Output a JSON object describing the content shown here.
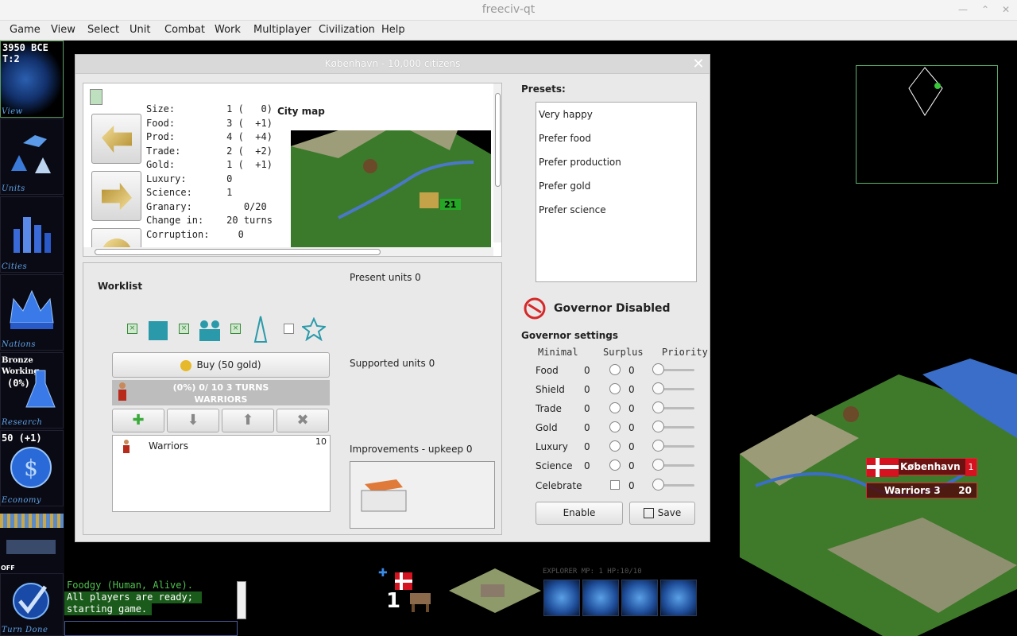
{
  "window": {
    "title": "freeciv-qt"
  },
  "menu": [
    "Game",
    "View",
    "Select",
    "Unit",
    "Combat",
    "Work",
    "Multiplayer",
    "Civilization",
    "Help"
  ],
  "sidebar": {
    "date": "3950 BCE",
    "turn": "T:2",
    "view_label": "View",
    "units_label": "Units",
    "cities_label": "Cities",
    "nations_label": "Nations",
    "research_title": "Bronze Working",
    "research_pct": "(0%)",
    "research_label": "Research",
    "gold": "50 (+1)",
    "economy_label": "Economy",
    "off_label": "OFF",
    "turn_done_label": "Turn Done"
  },
  "dialog": {
    "title": "København - 10,000 citizens",
    "stats": [
      {
        "label": "Size:",
        "value": "1 (   0)"
      },
      {
        "label": "Food:",
        "value": "3 (  +1)"
      },
      {
        "label": "Prod:",
        "value": "4 (  +4)"
      },
      {
        "label": "Trade:",
        "value": "2 (  +2)"
      },
      {
        "label": "Gold:",
        "value": "1 (  +1)"
      },
      {
        "label": "Luxury:",
        "value": "0"
      },
      {
        "label": "Science:",
        "value": "1"
      },
      {
        "label": "Granary:",
        "value": "   0/20"
      },
      {
        "label": "Change in:",
        "value": "20 turns"
      },
      {
        "label": "Corruption:",
        "value": "  0"
      }
    ],
    "city_map_label": "City map",
    "worklist_label": "Worklist",
    "buy_label": "Buy (50 gold)",
    "progress_line1": "(0%) 0/ 10 3 TURNS",
    "progress_line2": "WARRIORS",
    "worklist_items": [
      {
        "name": "Warriors",
        "cost": "10"
      }
    ],
    "present_units": "Present units 0",
    "supported_units": "Supported units 0",
    "improvements": "Improvements - upkeep 0",
    "presets_label": "Presets:",
    "presets": [
      "Very happy",
      "Prefer food",
      "Prefer production",
      "Prefer gold",
      "Prefer science"
    ],
    "governor_status": "Governor Disabled",
    "governor_settings_label": "Governor settings",
    "gov_headers": {
      "minimal": "Minimal",
      "surplus": "Surplus",
      "priority": "Priority"
    },
    "gov_rows": [
      {
        "name": "Food",
        "minimal": "0",
        "surplus": "0"
      },
      {
        "name": "Shield",
        "minimal": "0",
        "surplus": "0"
      },
      {
        "name": "Trade",
        "minimal": "0",
        "surplus": "0"
      },
      {
        "name": "Gold",
        "minimal": "0",
        "surplus": "0"
      },
      {
        "name": "Luxury",
        "minimal": "0",
        "surplus": "0"
      },
      {
        "name": "Science",
        "minimal": "0",
        "surplus": "0"
      },
      {
        "name": "Celebrate",
        "minimal": "",
        "surplus": "0"
      }
    ],
    "enable_label": "Enable",
    "save_label": "Save"
  },
  "map": {
    "city_name": "København",
    "city_size": "1",
    "unit_label": "Warriors 3",
    "unit_count": "20",
    "tile_food": "21"
  },
  "chat": {
    "lines": [
      "Foodgy (Human, Alive).",
      "All players are ready;",
      "starting game."
    ]
  },
  "unitbar": {
    "info": "EXPLORER MP: 1 HP:10/10",
    "stack_count": "1"
  },
  "colors": {
    "chat_green": "#4ec24e",
    "chat_bg_green": "#1a5a1a",
    "danish_red": "#d5121f",
    "sidebar_label": "#5fa3e8"
  }
}
